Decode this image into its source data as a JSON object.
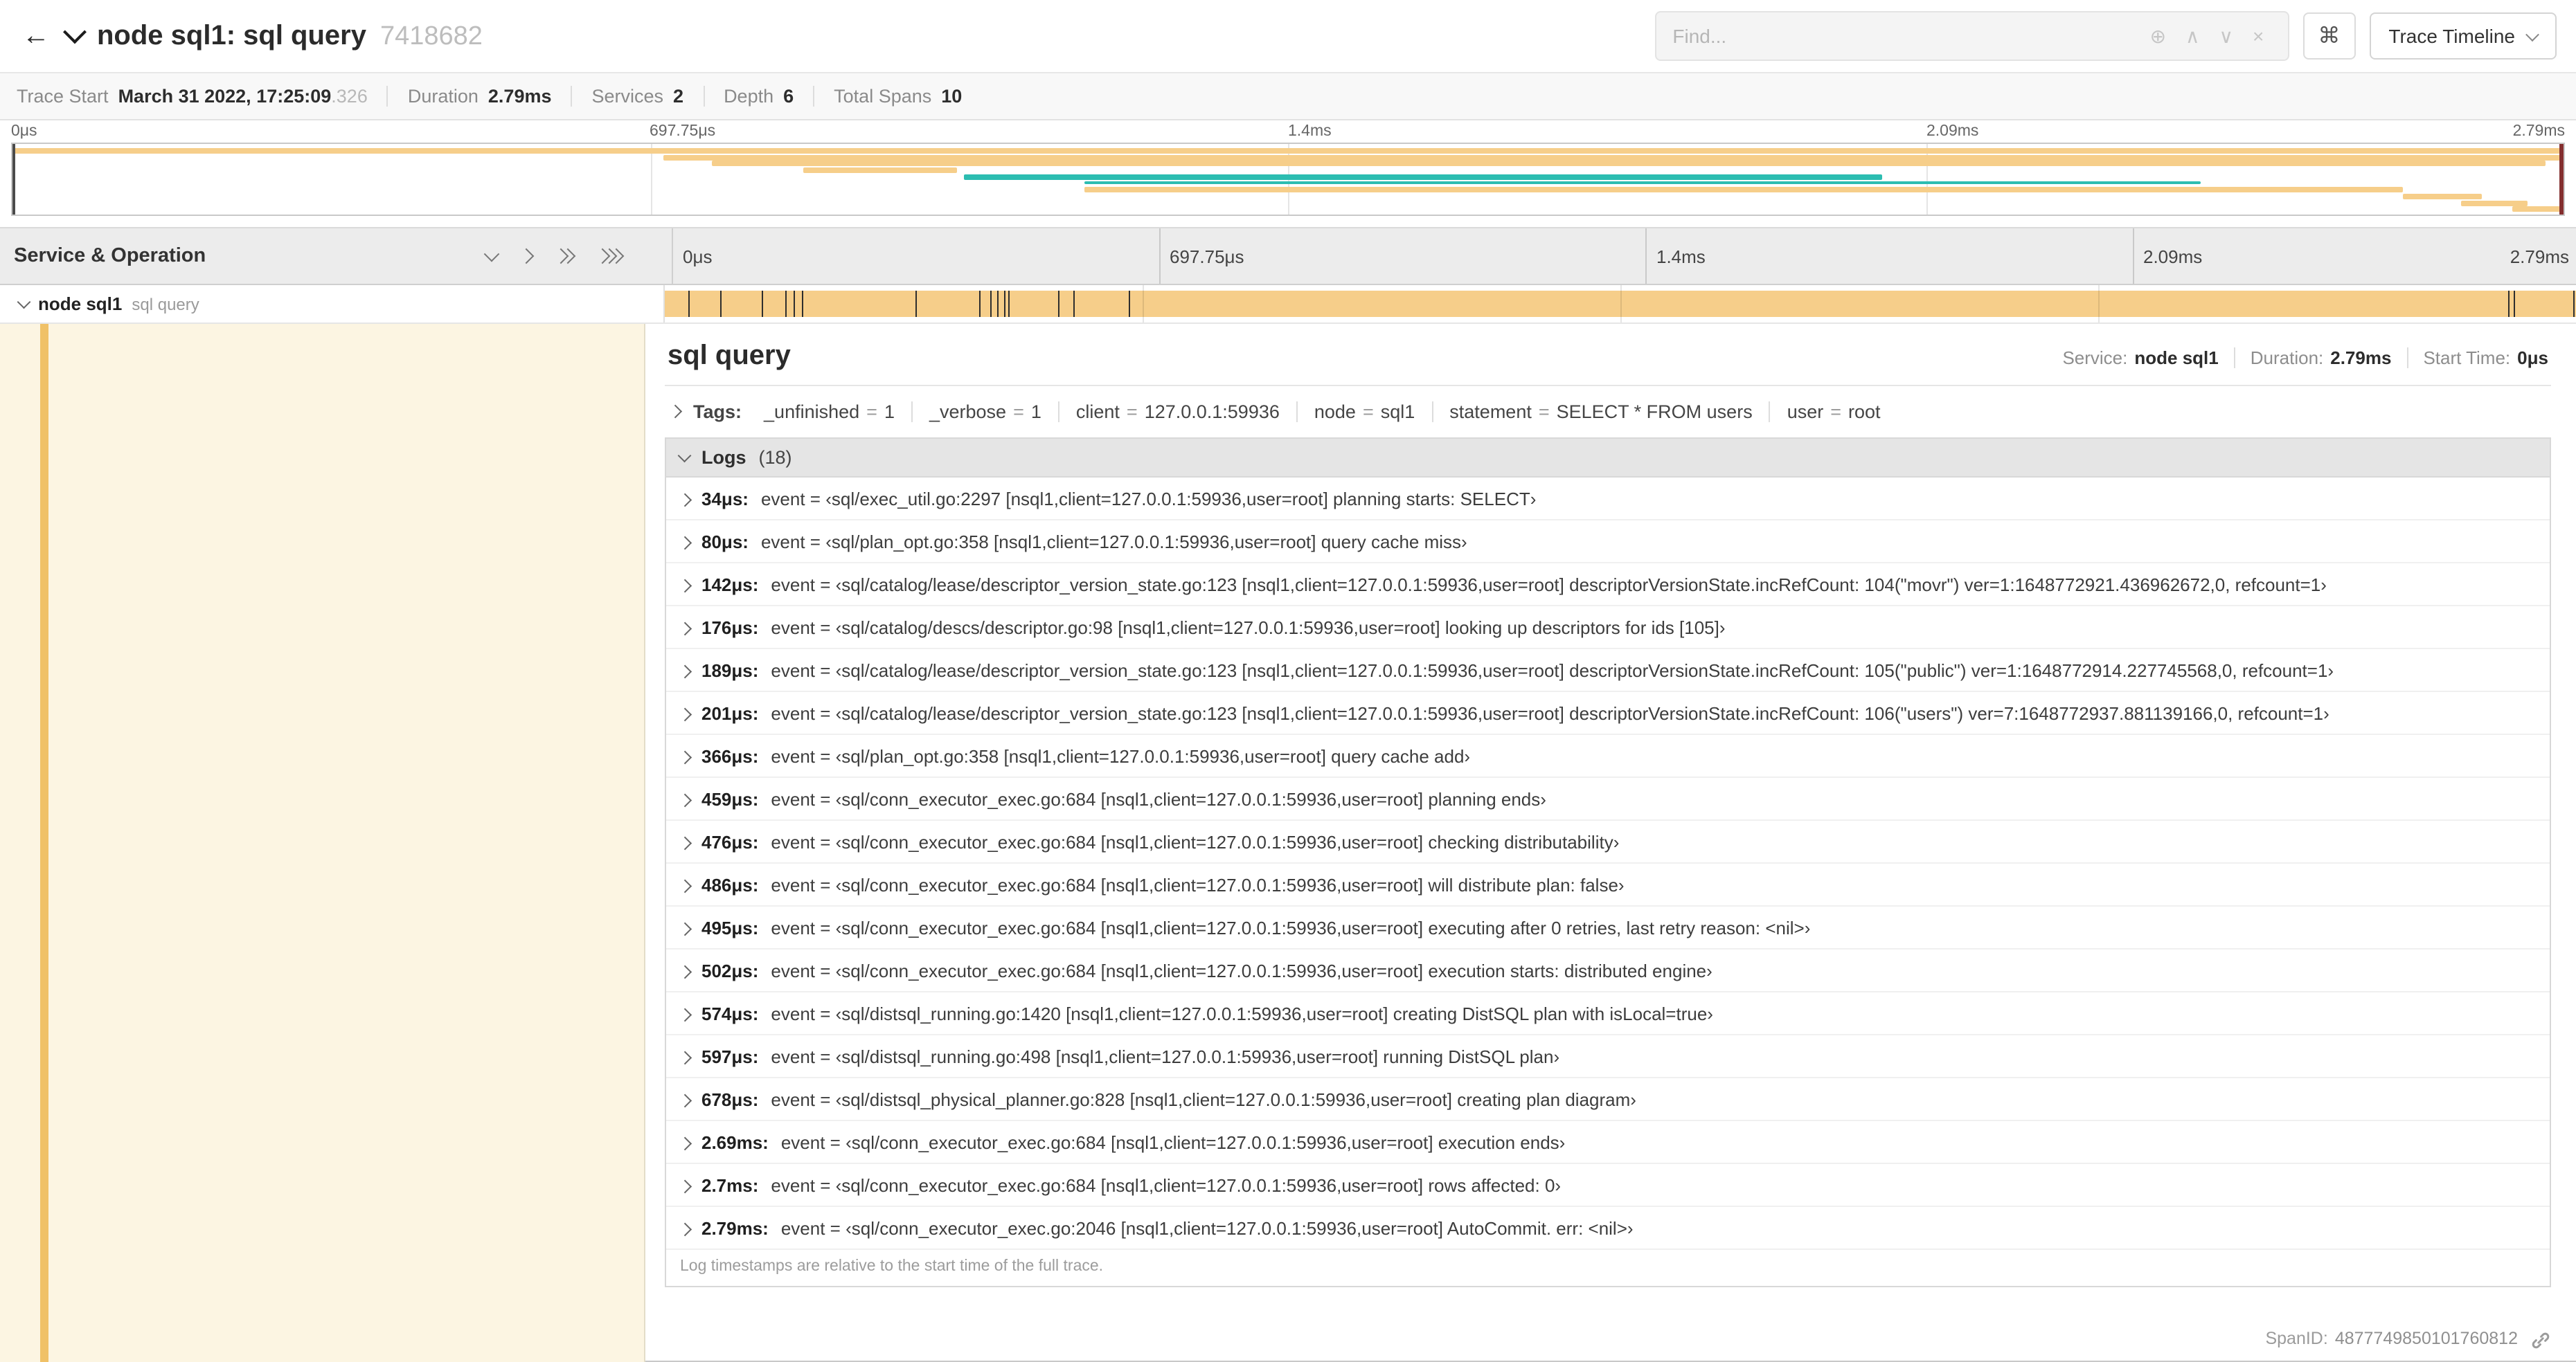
{
  "colors": {
    "span_tan": "#F6CE8A",
    "span_teal": "#2CBDB1",
    "detail_cream": "#FCF5E2",
    "accent_strip": "#F0C167",
    "scrubber_right": "#842F2F",
    "tick_dark": "#2e2e2e"
  },
  "header": {
    "back_icon": "←",
    "title": "node sql1: sql query",
    "trace_id": "7418682",
    "find_placeholder": "Find...",
    "find_icons": {
      "focus": "⊕",
      "prev": "∧",
      "next": "∨",
      "clear": "×"
    },
    "shortcut_button": "⌘",
    "view_selector": "Trace Timeline"
  },
  "trace_info": {
    "items": [
      {
        "label": "Trace Start",
        "value": "March 31 2022, 17:25:09",
        "suffix": ".326"
      },
      {
        "label": "Duration",
        "value": "2.79ms"
      },
      {
        "label": "Services",
        "value": "2"
      },
      {
        "label": "Depth",
        "value": "6"
      },
      {
        "label": "Total Spans",
        "value": "10"
      }
    ]
  },
  "minimap": {
    "ticks": [
      "0μs",
      "697.75μs",
      "1.4ms",
      "2.09ms",
      "2.79ms"
    ],
    "spans": [
      {
        "r": 0,
        "s": 0,
        "e": 100,
        "c": "tan"
      },
      {
        "r": 1,
        "s": 25.5,
        "e": 100,
        "c": "tan"
      },
      {
        "r": 2,
        "s": 27.4,
        "e": 99.3,
        "c": "tan"
      },
      {
        "r": 3,
        "s": 31,
        "e": 37,
        "c": "tan"
      },
      {
        "r": 4,
        "s": 37.3,
        "e": 73.3,
        "c": "teal"
      },
      {
        "r": 5,
        "s": 42,
        "e": 85.8,
        "c": "teal",
        "thin": true
      },
      {
        "r": 6,
        "s": 42,
        "e": 93.7,
        "c": "tan"
      },
      {
        "r": 7,
        "s": 93.7,
        "e": 96.8,
        "c": "tan"
      },
      {
        "r": 8,
        "s": 96,
        "e": 98.6,
        "c": "tan"
      },
      {
        "r": 9,
        "s": 98,
        "e": 100,
        "c": "tan"
      }
    ]
  },
  "timeline": {
    "left_header": "Service & Operation",
    "ticks": [
      "0μs",
      "697.75μs",
      "1.4ms",
      "2.09ms",
      "2.79ms"
    ],
    "span": {
      "service": "node sql1",
      "operation": "sql query"
    }
  },
  "trace": {
    "duration_us": 2790
  },
  "detail": {
    "title": "sql query",
    "summary": [
      {
        "label": "Service:",
        "value": "node sql1"
      },
      {
        "label": "Duration:",
        "value": "2.79ms"
      },
      {
        "label": "Start Time:",
        "value": "0μs"
      }
    ],
    "tags_label": "Tags:",
    "tags": [
      {
        "key": "_unfinished",
        "value": "1"
      },
      {
        "key": "_verbose",
        "value": "1"
      },
      {
        "key": "client",
        "value": "127.0.0.1:59936"
      },
      {
        "key": "node",
        "value": "sql1"
      },
      {
        "key": "statement",
        "value": "SELECT * FROM users"
      },
      {
        "key": "user",
        "value": "root"
      }
    ],
    "logs_label": "Logs",
    "logs_count": "(18)",
    "logs": [
      {
        "time": "34μs:",
        "t_us": 34,
        "text": "event = ‹sql/exec_util.go:2297 [nsql1,client=127.0.0.1:59936,user=root] planning starts: SELECT›"
      },
      {
        "time": "80μs:",
        "t_us": 80,
        "text": "event = ‹sql/plan_opt.go:358 [nsql1,client=127.0.0.1:59936,user=root] query cache miss›"
      },
      {
        "time": "142μs:",
        "t_us": 142,
        "text": "event = ‹sql/catalog/lease/descriptor_version_state.go:123 [nsql1,client=127.0.0.1:59936,user=root] descriptorVersionState.incRefCount: 104(\"movr\") ver=1:1648772921.436962672,0, refcount=1›"
      },
      {
        "time": "176μs:",
        "t_us": 176,
        "text": "event = ‹sql/catalog/descs/descriptor.go:98 [nsql1,client=127.0.0.1:59936,user=root] looking up descriptors for ids [105]›"
      },
      {
        "time": "189μs:",
        "t_us": 189,
        "text": "event = ‹sql/catalog/lease/descriptor_version_state.go:123 [nsql1,client=127.0.0.1:59936,user=root] descriptorVersionState.incRefCount: 105(\"public\") ver=1:1648772914.227745568,0, refcount=1›"
      },
      {
        "time": "201μs:",
        "t_us": 201,
        "text": "event = ‹sql/catalog/lease/descriptor_version_state.go:123 [nsql1,client=127.0.0.1:59936,user=root] descriptorVersionState.incRefCount: 106(\"users\") ver=7:1648772937.881139166,0, refcount=1›"
      },
      {
        "time": "366μs:",
        "t_us": 366,
        "text": "event = ‹sql/plan_opt.go:358 [nsql1,client=127.0.0.1:59936,user=root] query cache add›"
      },
      {
        "time": "459μs:",
        "t_us": 459,
        "text": "event = ‹sql/conn_executor_exec.go:684 [nsql1,client=127.0.0.1:59936,user=root] planning ends›"
      },
      {
        "time": "476μs:",
        "t_us": 476,
        "text": "event = ‹sql/conn_executor_exec.go:684 [nsql1,client=127.0.0.1:59936,user=root] checking distributability›"
      },
      {
        "time": "486μs:",
        "t_us": 486,
        "text": "event = ‹sql/conn_executor_exec.go:684 [nsql1,client=127.0.0.1:59936,user=root] will distribute plan: false›"
      },
      {
        "time": "495μs:",
        "t_us": 495,
        "text": "event = ‹sql/conn_executor_exec.go:684 [nsql1,client=127.0.0.1:59936,user=root] executing after 0 retries, last retry reason: <nil>›"
      },
      {
        "time": "502μs:",
        "t_us": 502,
        "text": "event = ‹sql/conn_executor_exec.go:684 [nsql1,client=127.0.0.1:59936,user=root] execution starts: distributed engine›"
      },
      {
        "time": "574μs:",
        "t_us": 574,
        "text": "event = ‹sql/distsql_running.go:1420 [nsql1,client=127.0.0.1:59936,user=root] creating DistSQL plan with isLocal=true›"
      },
      {
        "time": "597μs:",
        "t_us": 597,
        "text": "event = ‹sql/distsql_running.go:498 [nsql1,client=127.0.0.1:59936,user=root] running DistSQL plan›"
      },
      {
        "time": "678μs:",
        "t_us": 678,
        "text": "event = ‹sql/distsql_physical_planner.go:828 [nsql1,client=127.0.0.1:59936,user=root] creating plan diagram›"
      },
      {
        "time": "2.69ms:",
        "t_us": 2690,
        "text": "event = ‹sql/conn_executor_exec.go:684 [nsql1,client=127.0.0.1:59936,user=root] execution ends›"
      },
      {
        "time": "2.7ms:",
        "t_us": 2700,
        "text": "event = ‹sql/conn_executor_exec.go:684 [nsql1,client=127.0.0.1:59936,user=root] rows affected: 0›"
      },
      {
        "time": "2.79ms:",
        "t_us": 2790,
        "text": "event = ‹sql/conn_executor_exec.go:2046 [nsql1,client=127.0.0.1:59936,user=root] AutoCommit. err: <nil>›"
      }
    ],
    "logs_note": "Log timestamps are relative to the start time of the full trace.",
    "span_id_label": "SpanID:",
    "span_id": "4877749850101760812"
  }
}
